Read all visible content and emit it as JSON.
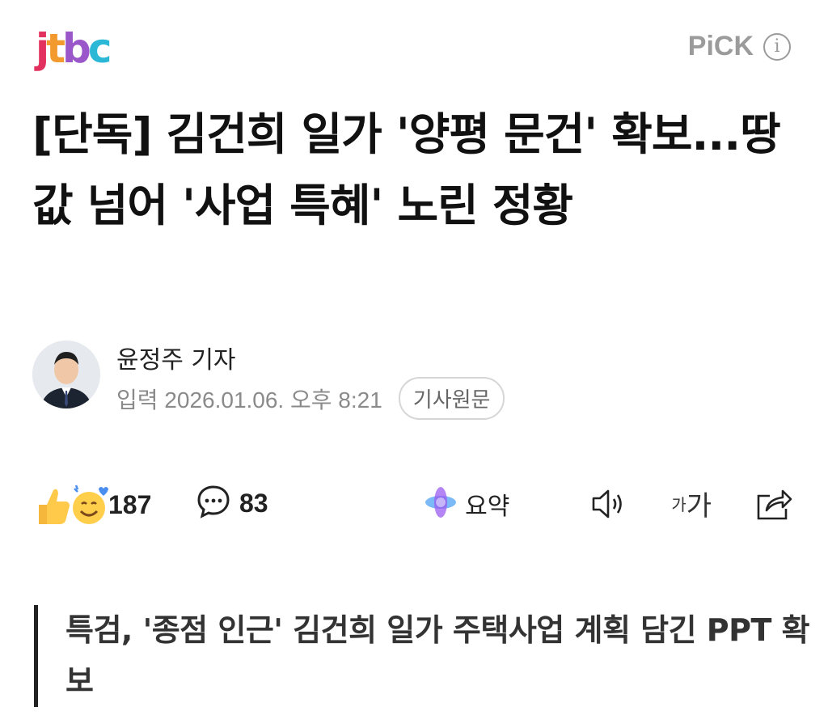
{
  "brand": {
    "logo_parts": [
      "j",
      "t",
      "b",
      "c"
    ]
  },
  "pick": {
    "label": "PiCK",
    "icon": "info-icon"
  },
  "article": {
    "headline": "[단독] 김건희 일가 '양평 문건' 확보...땅값 넘어 '사업 특혜' 노린 정황",
    "reporter": "윤정주 기자",
    "published": "입력 2026.01.06. 오후 8:21",
    "original_button": "기사원문",
    "subhead": "특검, '종점 인근' 김건희 일가 주택사업 계획 담긴 PPT 확보"
  },
  "reactions": {
    "icon": "like-emoji-icon",
    "count": "187"
  },
  "comments": {
    "icon": "comment-icon",
    "count": "83"
  },
  "tools": {
    "summary_label": "요약",
    "summary_icon": "ai-summary-icon",
    "tts_icon": "speaker-icon",
    "font_small": "가",
    "font_big": "가",
    "share_icon": "share-icon"
  },
  "colors": {
    "logo_red": "#e2315e",
    "logo_orange": "#f29a2e",
    "logo_purple": "#9a57c9",
    "logo_cyan": "#2bb7d6",
    "muted": "#9b9b9b"
  }
}
